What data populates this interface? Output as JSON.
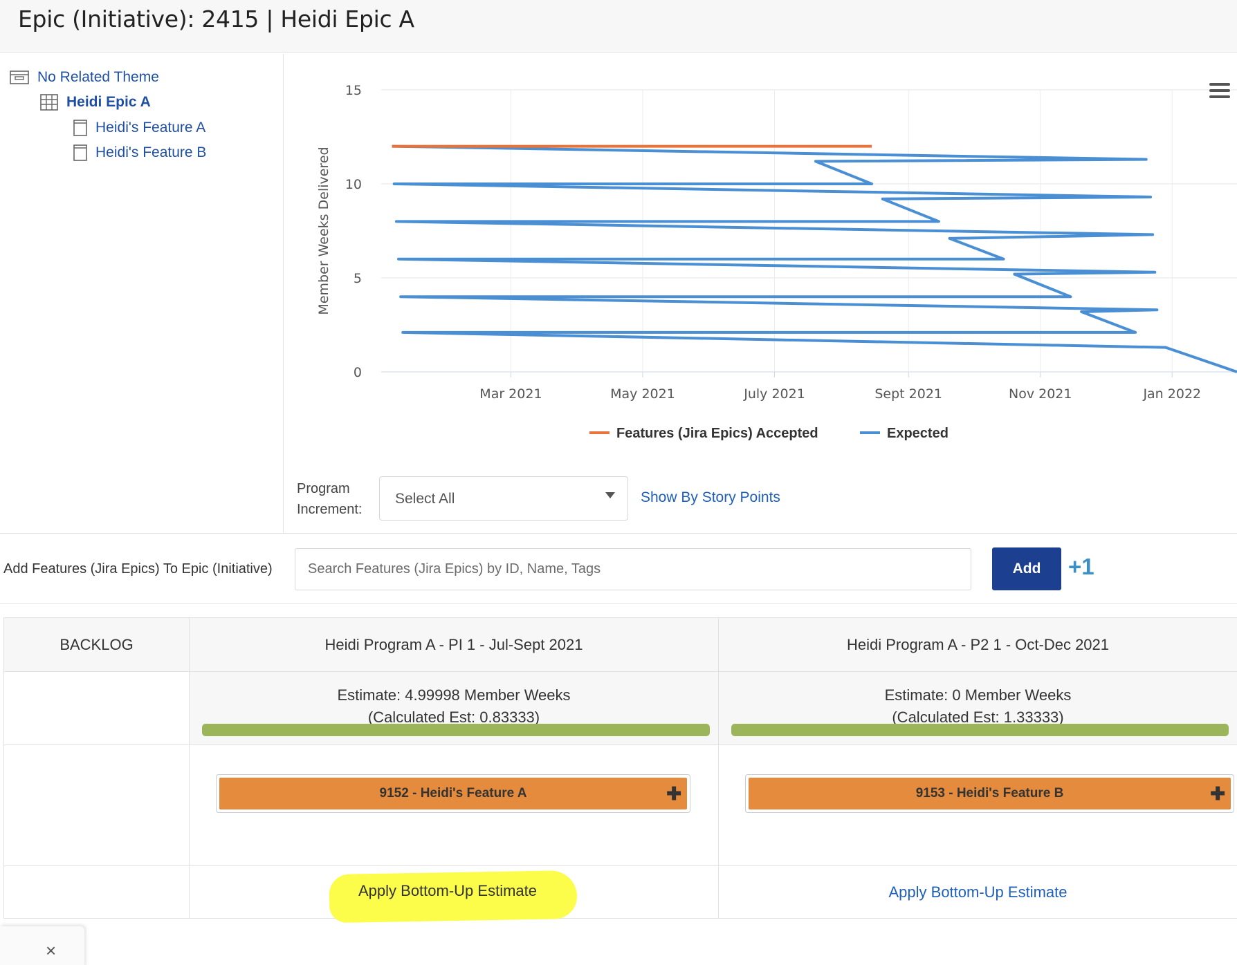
{
  "header": {
    "title": "Epic (Initiative): 2415 | Heidi Epic A"
  },
  "tree": {
    "theme": "No Related Theme",
    "epic": "Heidi Epic A",
    "features": [
      "Heidi's Feature A",
      "Heidi's Feature B"
    ]
  },
  "chart_data": {
    "type": "line",
    "title": "",
    "xlabel": "",
    "ylabel": "Member Weeks Delivered",
    "ylim": [
      0,
      15
    ],
    "yticks": [
      "0",
      "5",
      "10",
      "15"
    ],
    "xticks": [
      "Mar 2021",
      "May 2021",
      "July 2021",
      "Sept 2021",
      "Nov 2021",
      "Jan 2022"
    ],
    "grid": true,
    "legend_position": "bottom-center",
    "colors": {
      "accepted": "#e8743b",
      "expected": "#4a8fd4"
    },
    "series": [
      {
        "name": "Features (Jira Epics) Accepted",
        "points": [
          [
            "2021-01-05",
            12.0
          ],
          [
            "2021-08-15",
            12.0
          ]
        ]
      },
      {
        "name": "Expected",
        "points": [
          [
            "2021-01-05",
            12.0
          ],
          [
            "2021-12-20",
            11.3
          ],
          [
            "2021-07-20",
            11.2
          ],
          [
            "2021-08-15",
            10.0
          ],
          [
            "2021-01-06",
            10.0
          ],
          [
            "2021-12-22",
            9.3
          ],
          [
            "2021-08-20",
            9.2
          ],
          [
            "2021-09-15",
            8.0
          ],
          [
            "2021-01-07",
            8.0
          ],
          [
            "2021-12-23",
            7.3
          ],
          [
            "2021-09-20",
            7.1
          ],
          [
            "2021-10-15",
            6.0
          ],
          [
            "2021-01-08",
            6.0
          ],
          [
            "2021-12-24",
            5.3
          ],
          [
            "2021-10-20",
            5.2
          ],
          [
            "2021-11-15",
            4.0
          ],
          [
            "2021-01-09",
            4.0
          ],
          [
            "2021-12-25",
            3.3
          ],
          [
            "2021-11-20",
            3.2
          ],
          [
            "2021-12-15",
            2.1
          ],
          [
            "2021-01-10",
            2.1
          ],
          [
            "2021-12-29",
            1.3
          ],
          [
            "2022-01-31",
            0.0
          ]
        ]
      }
    ]
  },
  "filters": {
    "pi_label": "Program Increment:",
    "pi_value": "Select All",
    "story_points_link": "Show By Story Points"
  },
  "add_section": {
    "label": "Add Features (Jira Epics) To Epic (Initiative)",
    "search_placeholder": "Search Features (Jira Epics) by ID, Name, Tags",
    "add_button": "Add",
    "plus_one": "+1"
  },
  "board": {
    "backlog": "BACKLOG",
    "columns": [
      {
        "title": "Heidi Program A - PI 1 - Jul-Sept 2021",
        "estimate": "Estimate: 4.99998 Member Weeks",
        "calculated": "(Calculated Est: 0.83333)",
        "feature": "9152 - Heidi's Feature A",
        "apply": "Apply Bottom-Up Estimate"
      },
      {
        "title": "Heidi Program A - P2 1 - Oct-Dec 2021",
        "estimate": "Estimate: 0 Member Weeks",
        "calculated": "(Calculated Est: 1.33333)",
        "feature": "9153 - Heidi's Feature B",
        "apply": "Apply Bottom-Up Estimate"
      }
    ]
  },
  "bottom_tab": {
    "close": "×"
  }
}
